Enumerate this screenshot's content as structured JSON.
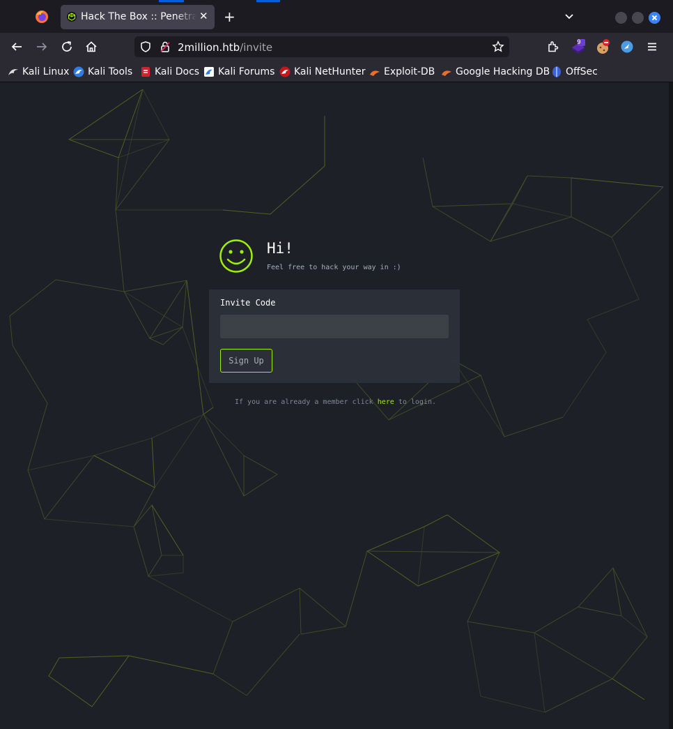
{
  "browser": {
    "tab_title": "Hack The Box :: Penetration Testing Labs",
    "url_host": "2million.htb",
    "url_path": "/invite",
    "extension_badge": "9",
    "bookmarks": [
      {
        "label": "Kali Linux",
        "icon": "kali-dragon-icon"
      },
      {
        "label": "Kali Tools",
        "icon": "kali-tools-icon"
      },
      {
        "label": "Kali Docs",
        "icon": "kali-docs-icon"
      },
      {
        "label": "Kali Forums",
        "icon": "kali-forums-icon"
      },
      {
        "label": "Kali NetHunter",
        "icon": "kali-nethunter-icon"
      },
      {
        "label": "Exploit-DB",
        "icon": "exploit-db-icon"
      },
      {
        "label": "Google Hacking DB",
        "icon": "ghdb-icon"
      },
      {
        "label": "OffSec",
        "icon": "offsec-icon"
      }
    ]
  },
  "page": {
    "greeting": "Hi!",
    "subtitle": "Feel free to hack your way in :)",
    "form": {
      "invite_label": "Invite Code",
      "invite_value": "",
      "signup_label": "Sign Up"
    },
    "login_prefix": "If you are already a member click ",
    "login_link": "here",
    "login_suffix": " to login.",
    "accent_color": "#9fef00",
    "background_color": "#1d2127"
  }
}
